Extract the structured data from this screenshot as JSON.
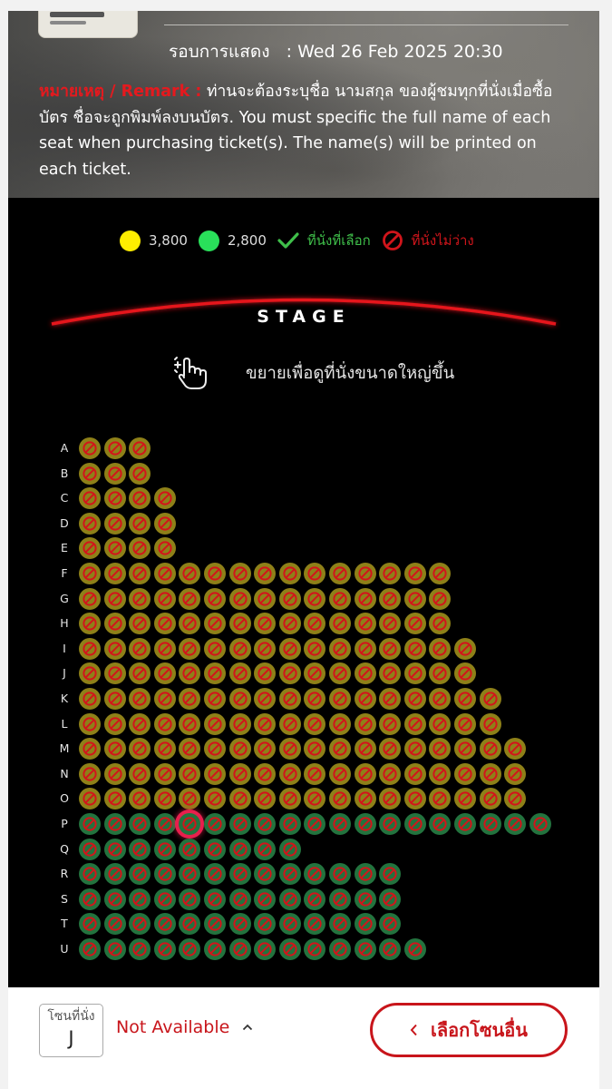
{
  "header": {
    "showtime_label": "รอบการแสดง",
    "showtime_value": "Wed 26 Feb 2025 20:30",
    "remark_label": "หมายเหตุ / Remark :",
    "remark_text": "ท่านจะต้องระบุชื่อ นามสกุล ของผู้ชมทุกที่นั่งเมื่อซื้อบัตร ชื่อจะถูกพิมพ์ลงบนบัตร. You must specific the full name of each seat when purchasing ticket(s). The name(s) will be printed on each ticket."
  },
  "legend": {
    "price_1": "3,800",
    "price_1_color": "#ffee00",
    "price_2": "2,800",
    "price_2_color": "#29e05a",
    "selected_label": "ที่นั่งที่เลือก",
    "unavailable_label": "ที่นั่งไม่ว่าง"
  },
  "stage": {
    "label": "STAGE"
  },
  "zoom_hint": "ขยายเพื่อดูที่นั่งขนาดใหญ่ขึ้น",
  "seatmap": {
    "rows": [
      {
        "label": "A",
        "seats": 3,
        "price": "3800"
      },
      {
        "label": "B",
        "seats": 3,
        "price": "3800"
      },
      {
        "label": "C",
        "seats": 4,
        "price": "3800"
      },
      {
        "label": "D",
        "seats": 4,
        "price": "3800"
      },
      {
        "label": "E",
        "seats": 4,
        "price": "3800"
      },
      {
        "label": "F",
        "seats": 15,
        "price": "3800"
      },
      {
        "label": "G",
        "seats": 15,
        "price": "3800"
      },
      {
        "label": "H",
        "seats": 15,
        "price": "3800"
      },
      {
        "label": "I",
        "seats": 16,
        "price": "3800"
      },
      {
        "label": "J",
        "seats": 16,
        "price": "3800"
      },
      {
        "label": "K",
        "seats": 17,
        "price": "3800"
      },
      {
        "label": "L",
        "seats": 17,
        "price": "3800"
      },
      {
        "label": "M",
        "seats": 18,
        "price": "3800"
      },
      {
        "label": "N",
        "seats": 18,
        "price": "3800"
      },
      {
        "label": "O",
        "seats": 18,
        "price": "3800"
      },
      {
        "label": "P",
        "seats": 19,
        "price": "2800"
      },
      {
        "label": "Q",
        "seats": 9,
        "price": "2800"
      },
      {
        "label": "R",
        "seats": 13,
        "price": "2800"
      },
      {
        "label": "S",
        "seats": 13,
        "price": "2800"
      },
      {
        "label": "T",
        "seats": 13,
        "price": "2800"
      },
      {
        "label": "U",
        "seats": 14,
        "price": "2800"
      }
    ],
    "status": "unavailable",
    "highlight_seat": {
      "row": "P",
      "seat": 5
    }
  },
  "bottom_bar": {
    "zone_label": "โซนที่นั่ง",
    "zone_value": "J",
    "zone_status": "Not Available",
    "other_zone_button": "เลือกโซนอื่น"
  },
  "colors": {
    "accent_red": "#c8151b",
    "seat_3800": "#8e8018",
    "seat_2800": "#23733e",
    "highlight": "#e81f4d"
  }
}
